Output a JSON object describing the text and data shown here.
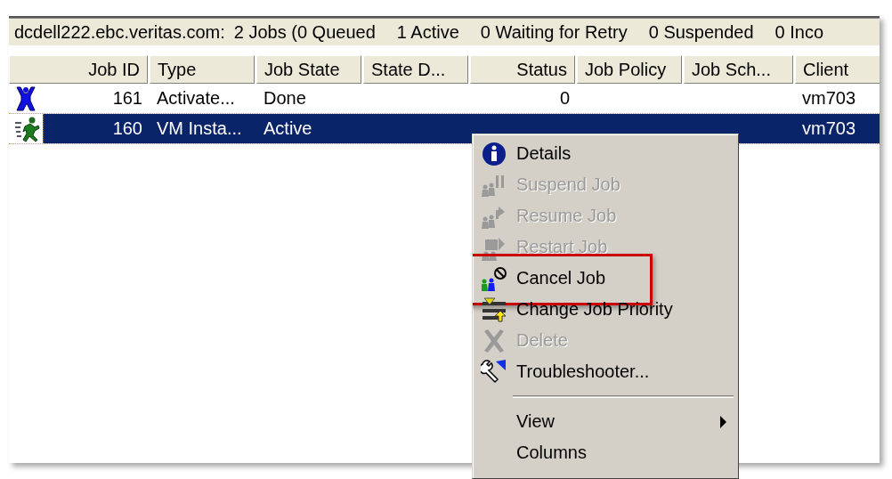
{
  "status_bar": {
    "host": "dcdell222.ebc.veritas.com:",
    "segments": [
      "2 Jobs (0 Queued",
      "1 Active",
      "0 Waiting for Retry",
      "0 Suspended",
      "0 Inco"
    ]
  },
  "table": {
    "columns": [
      {
        "label": "Job ID"
      },
      {
        "label": "Type"
      },
      {
        "label": "Job State"
      },
      {
        "label": "State D..."
      },
      {
        "label": "Status"
      },
      {
        "label": "Job Policy"
      },
      {
        "label": "Job Sch..."
      },
      {
        "label": "Client"
      }
    ],
    "rows": [
      {
        "kind": "done",
        "selected": false,
        "cells": [
          "161",
          "Activate...",
          "Done",
          "",
          "0",
          "",
          "",
          "vm703"
        ]
      },
      {
        "kind": "active",
        "selected": true,
        "cells": [
          "160",
          "VM Insta...",
          "Active",
          "",
          "",
          "",
          "",
          "vm703"
        ]
      }
    ]
  },
  "context_menu": {
    "items": [
      {
        "kind": "item",
        "label": "Details",
        "disabled": false,
        "highlighted": false
      },
      {
        "kind": "item",
        "label": "Suspend Job",
        "disabled": true,
        "highlighted": false
      },
      {
        "kind": "item",
        "label": "Resume Job",
        "disabled": true,
        "highlighted": false
      },
      {
        "kind": "item",
        "label": "Restart Job",
        "disabled": true,
        "highlighted": false
      },
      {
        "kind": "item",
        "label": "Cancel Job",
        "disabled": false,
        "highlighted": true
      },
      {
        "kind": "item",
        "label": "Change Job Priority",
        "disabled": false,
        "highlighted": false
      },
      {
        "kind": "item",
        "label": "Delete",
        "disabled": true,
        "highlighted": false
      },
      {
        "kind": "item",
        "label": "Troubleshooter...",
        "disabled": false,
        "highlighted": false
      },
      {
        "kind": "separator"
      },
      {
        "kind": "submenu",
        "label": "View",
        "disabled": false,
        "highlighted": false
      },
      {
        "kind": "item",
        "label": "Columns",
        "disabled": false,
        "highlighted": false
      }
    ]
  }
}
